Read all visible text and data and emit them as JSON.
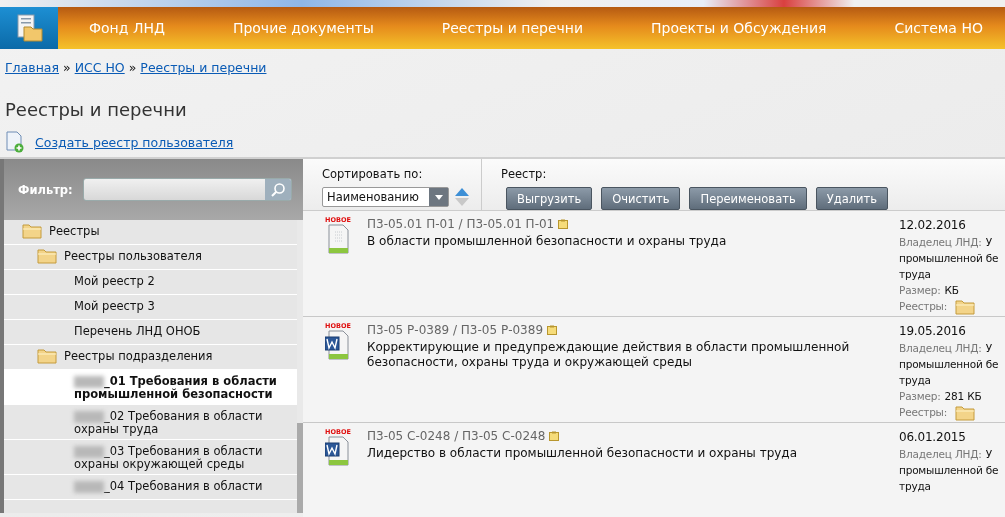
{
  "nav": [
    {
      "label": "Фонд ЛНД"
    },
    {
      "label": "Прочие документы"
    },
    {
      "label": "Реестры и перечни"
    },
    {
      "label": "Проекты и Обсуждения"
    },
    {
      "label": "Система НО"
    }
  ],
  "breadcrumbs": [
    {
      "label": "Главная",
      "kind": "link"
    },
    {
      "label": "»",
      "kind": "sep"
    },
    {
      "label": "ИСС НО",
      "kind": "link"
    },
    {
      "label": "»",
      "kind": "sep"
    },
    {
      "label": "Реестры и перечни",
      "kind": "link"
    }
  ],
  "page_title": "Реестры и перечни",
  "create_link": "Создать реестр пользователя",
  "filter": {
    "label": "Фильтр:"
  },
  "tree": [
    {
      "label": "Реестры",
      "kind": "folder",
      "selected": false,
      "redacted": false,
      "children": [
        {
          "label": "Реестры пользователя",
          "kind": "folder",
          "selected": false,
          "redacted": false,
          "children": [
            {
              "label": "Мой реестр 2",
              "kind": "item",
              "selected": false,
              "redacted": false
            },
            {
              "label": "Мой реестр 3",
              "kind": "item",
              "selected": false,
              "redacted": false
            },
            {
              "label": "Перечень ЛНД ОНОБ",
              "kind": "item",
              "selected": false,
              "redacted": false
            }
          ]
        },
        {
          "label": "Реестры подразделения",
          "kind": "folder",
          "selected": false,
          "redacted": false,
          "children": [
            {
              "label": "_01 Требования в области промышленной безопасности",
              "kind": "item",
              "selected": true,
              "redacted": true
            },
            {
              "label": "_02 Требования в области охраны труда",
              "kind": "item",
              "selected": false,
              "redacted": true
            },
            {
              "label": "_03 Требования в области охраны окружающей среды",
              "kind": "item",
              "selected": false,
              "redacted": true
            },
            {
              "label": "_04 Требования в области",
              "kind": "item",
              "selected": false,
              "redacted": true
            }
          ]
        }
      ]
    }
  ],
  "sort": {
    "label": "Сортировать по:",
    "value": "Наименованию",
    "ascending": true
  },
  "registry": {
    "label": "Реестр:",
    "buttons": [
      "Выгрузить",
      "Очистить",
      "Переименовать",
      "Удалить"
    ]
  },
  "documents": [
    {
      "kind": "generic",
      "badge": "НОВОЕ",
      "code": "П3-05.01 П-01 / П3-05.01 П-01",
      "title": "В области промышленной безопасности и охраны труда",
      "date": "12.02.2016",
      "owner_label": "Владелец ЛНД:",
      "owner_lines": [
        "У",
        "промышленной бе",
        "труда"
      ],
      "size_label": "Размер:",
      "size": "КБ",
      "registries_label": "Реестры:"
    },
    {
      "kind": "word",
      "badge": "НОВОЕ",
      "code": "П3-05 Р-0389 / П3-05 Р-0389",
      "title": "Корректирующие и предупреждающие действия в области промышленной безопасности, охраны труда и окружающей среды",
      "date": "19.05.2016",
      "owner_label": "Владелец ЛНД:",
      "owner_lines": [
        "У",
        "промышленной бе",
        "труда"
      ],
      "size_label": "Размер:",
      "size": "281 КБ",
      "registries_label": "Реестры:"
    },
    {
      "kind": "word",
      "badge": "НОВОЕ",
      "code": "П3-05 С-0248 / П3-05 С-0248",
      "title": "Лидерство в области промышленной безопасности и охраны труда",
      "date": "06.01.2015",
      "owner_label": "Владелец ЛНД:",
      "owner_lines": [
        "У",
        "промышленной бе",
        "труда"
      ]
    }
  ]
}
